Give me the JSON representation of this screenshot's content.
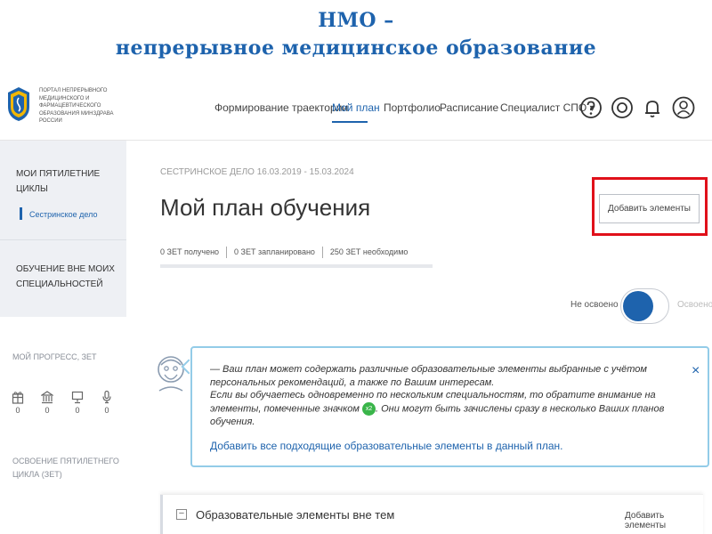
{
  "slide": {
    "title_line1": "НМО –",
    "title_line2": "непрерывное медицинское образование"
  },
  "header": {
    "logo_text": "Портал непрерывного медицинского и фармацевтического образования Минздрава России",
    "nav": [
      {
        "label": "Формирование траектории"
      },
      {
        "label": "Мой план"
      },
      {
        "label": "Портфолио"
      },
      {
        "label": "Расписание"
      },
      {
        "label": "Специалист СПО ▾"
      }
    ],
    "active_nav": "Мой план",
    "icons": [
      "help-icon",
      "target-icon",
      "bell-icon",
      "user-icon"
    ]
  },
  "sidebar": {
    "cycles_heading": "Мои пятилетние циклы",
    "cycle_item": "Сестринское дело",
    "other_heading_1": "Обучение вне моих",
    "other_heading_2": "специальностей",
    "progress_label": "Мой прогресс, ЗЕТ",
    "progress": [
      {
        "icon": "gift-icon",
        "value": "0"
      },
      {
        "icon": "building-icon",
        "value": "0"
      },
      {
        "icon": "monitor-icon",
        "value": "0"
      },
      {
        "icon": "microphone-icon",
        "value": "0"
      }
    ],
    "mastery_label_1": "Освоение пятилетнего",
    "mastery_label_2": "цикла (ЗЕТ)"
  },
  "main": {
    "breadcrumb": "Сестринское дело 16.03.2019 - 15.03.2024",
    "title": "Мой план обучения",
    "stats": {
      "received": "0 ЗЕТ получено",
      "planned": "0 ЗЕТ запланировано",
      "required": "250 ЗЕТ необходимо"
    },
    "add_button": "Добавить элементы",
    "toggle_left": "Не освоено",
    "toggle_right": "Освоено",
    "notice": {
      "line1": "— Ваш план может содержать различные образовательные элементы выбранные с учётом персональных рекомендаций, а также по Вашим интересам.",
      "line2a": "Если вы обучаетесь одновременно по нескольким специальностям, то обратите внимание на элементы, помеченные значком",
      "badge": "x2",
      "line2b": ". Они могут быть зачислены сразу в несколько Ваших планов обучения.",
      "link": "Добавить все подходящие образовательные элементы в данный план.",
      "close": "×"
    },
    "section": {
      "title": "Образовательные элементы вне тем",
      "link": "Добавить элементы",
      "collapse": "−"
    }
  },
  "colors": {
    "accent": "#1e63ad",
    "highlight": "#e0101a",
    "notice_border": "#93cce8",
    "badge": "#3ab54a"
  }
}
